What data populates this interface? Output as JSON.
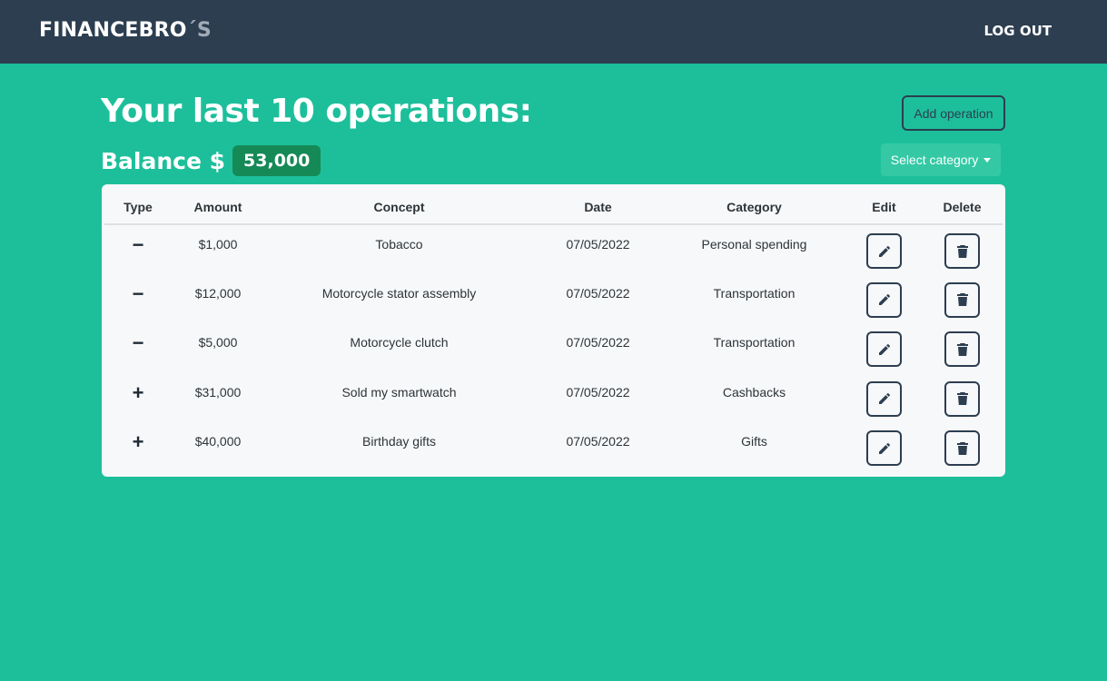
{
  "navbar": {
    "brand_main": "FINANCEBRO",
    "brand_suffix": "´S",
    "logout_label": "LOG OUT"
  },
  "header": {
    "title": "Your last 10 operations:",
    "balance_label": "Balance $",
    "balance_value": "53,000",
    "add_operation_label": "Add operation",
    "select_category_label": "Select category"
  },
  "table": {
    "columns": [
      "Type",
      "Amount",
      "Concept",
      "Date",
      "Category",
      "Edit",
      "Delete"
    ],
    "rows": [
      {
        "type": "−",
        "amount": "$1,000",
        "concept": "Tobacco",
        "date": "07/05/2022",
        "category": "Personal spending"
      },
      {
        "type": "−",
        "amount": "$12,000",
        "concept": "Motorcycle stator assembly",
        "date": "07/05/2022",
        "category": "Transportation"
      },
      {
        "type": "−",
        "amount": "$5,000",
        "concept": "Motorcycle clutch",
        "date": "07/05/2022",
        "category": "Transportation"
      },
      {
        "type": "+",
        "amount": "$31,000",
        "concept": "Sold my smartwatch",
        "date": "07/05/2022",
        "category": "Cashbacks"
      },
      {
        "type": "+",
        "amount": "$40,000",
        "concept": "Birthday gifts",
        "date": "07/05/2022",
        "category": "Gifts"
      }
    ]
  },
  "colors": {
    "background": "#1dbf9b",
    "navbar": "#2c3e50",
    "balance_badge": "#158a57",
    "card": "#f7f8fa"
  },
  "icons": {
    "edit": "pencil-icon",
    "delete": "trash-icon"
  }
}
